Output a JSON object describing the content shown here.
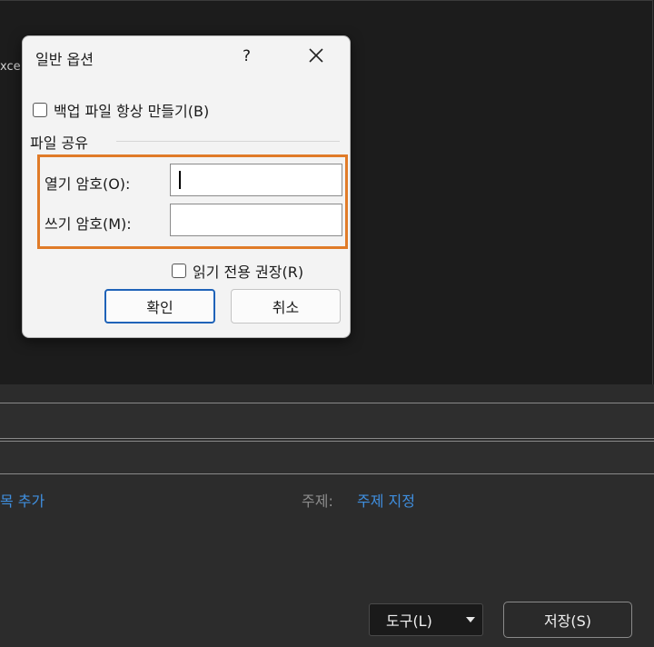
{
  "background": {
    "left_fragment": "xce",
    "add_tag_link": "목 추가",
    "subject_label": "주제:",
    "subject_link": "주제 지정",
    "tools_button": "도구(L)",
    "save_button": "저장(S)"
  },
  "dialog": {
    "title": "일반 옵션",
    "help": "?",
    "backup_checkbox": {
      "label": "백업 파일 항상 만들기(B)",
      "checked": false
    },
    "section": "파일 공유",
    "open_password": {
      "label": "열기 암호(O):",
      "value": ""
    },
    "modify_password": {
      "label": "쓰기 암호(M):",
      "value": ""
    },
    "readonly_checkbox": {
      "label": "읽기 전용 권장(R)",
      "checked": false
    },
    "ok_button": "확인",
    "cancel_button": "취소"
  },
  "colors": {
    "highlight": "#e07b28",
    "link": "#3f8fe0",
    "primary_button_border": "#1f63b8"
  }
}
